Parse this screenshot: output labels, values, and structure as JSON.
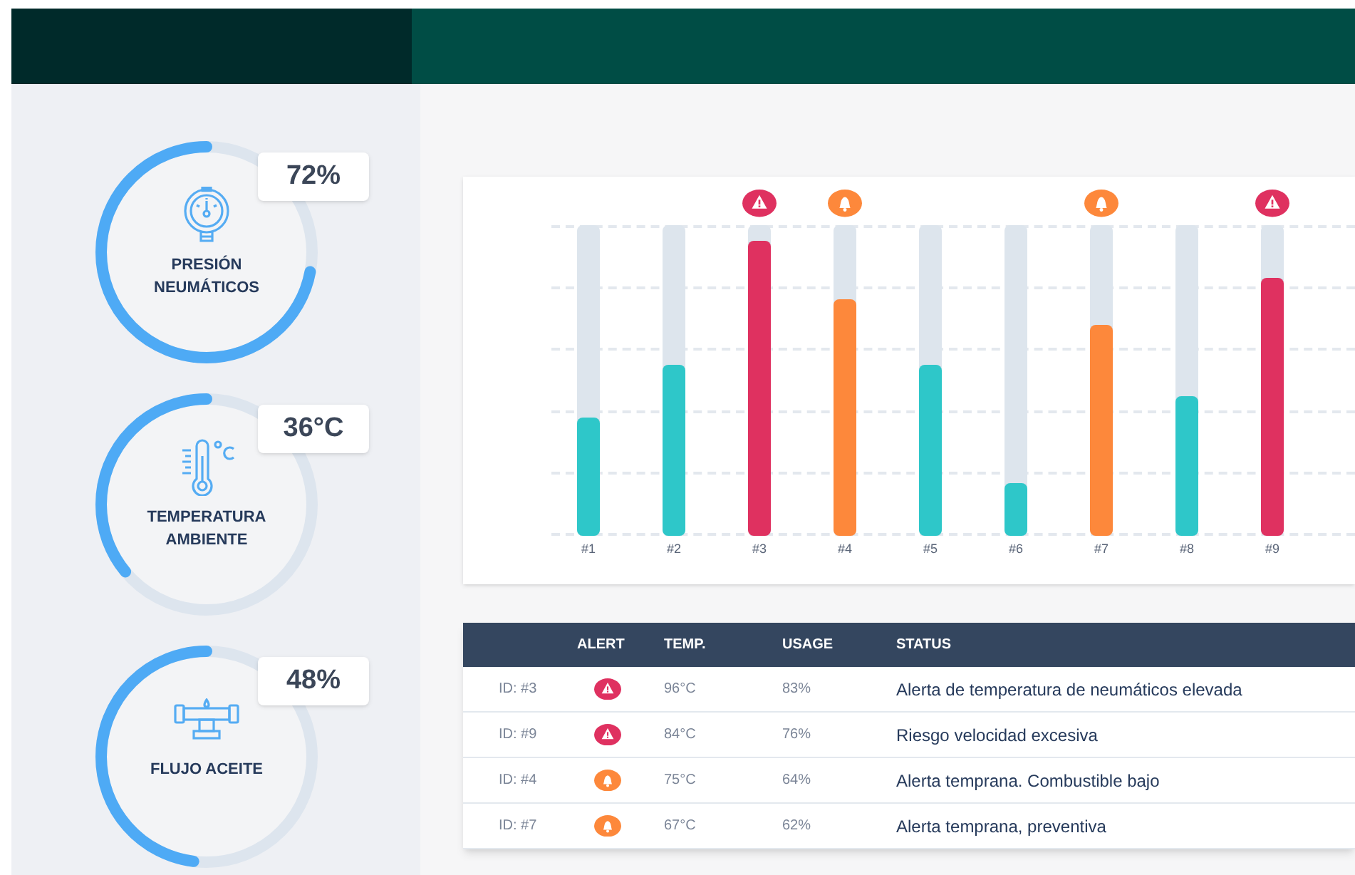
{
  "gauges": [
    {
      "value": "72%",
      "label": "PRESIÓN NEUMÁTICOS",
      "level": 0.72,
      "kind": "pressure"
    },
    {
      "value": "36°C",
      "label": "TEMPERATURA AMBIENTE",
      "level": 0.36,
      "kind": "temperature"
    },
    {
      "value": "48%",
      "label": "FLUJO ACEITE",
      "level": 0.48,
      "kind": "flow"
    }
  ],
  "bars": [
    {
      "label": "#1",
      "level": 0.38,
      "kind": "normal"
    },
    {
      "label": "#2",
      "level": 0.55,
      "kind": "normal"
    },
    {
      "label": "#3",
      "level": 0.95,
      "kind": "danger"
    },
    {
      "label": "#4",
      "level": 0.76,
      "kind": "warning"
    },
    {
      "label": "#5",
      "level": 0.55,
      "kind": "normal"
    },
    {
      "label": "#6",
      "level": 0.17,
      "kind": "normal"
    },
    {
      "label": "#7",
      "level": 0.68,
      "kind": "warning"
    },
    {
      "label": "#8",
      "level": 0.45,
      "kind": "normal"
    },
    {
      "label": "#9",
      "level": 0.83,
      "kind": "danger"
    }
  ],
  "table": {
    "columns": [
      "ALERT",
      "TEMP.",
      "USAGE",
      "STATUS"
    ],
    "rows": [
      {
        "id": "ID: #3",
        "kind": "danger",
        "temp": "96°C",
        "usage": "83%",
        "status": "Alerta de temperatura de neumáticos elevada"
      },
      {
        "id": "ID: #9",
        "kind": "danger",
        "temp": "84°C",
        "usage": "76%",
        "status": "Riesgo velocidad excesiva"
      },
      {
        "id": "ID: #4",
        "kind": "warning",
        "temp": "75°C",
        "usage": "64%",
        "status": "Alerta temprana. Combustible bajo"
      },
      {
        "id": "ID: #7",
        "kind": "warning",
        "temp": "67°C",
        "usage": "62%",
        "status": "Alerta temprana, preventiva"
      }
    ]
  }
}
